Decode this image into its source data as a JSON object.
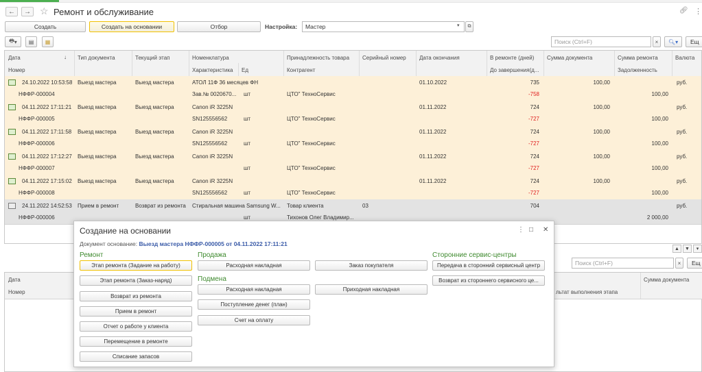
{
  "window": {
    "title": "Ремонт и обслуживание",
    "back": "←",
    "forward": "→",
    "star": "☆",
    "link_icon": "🔗",
    "more_icon": "⋮"
  },
  "toolbar": {
    "create": "Создать",
    "create_based_on": "Создать на основании",
    "filter": "Отбор",
    "setting_label": "Настройка:",
    "setting_value": "Мастер",
    "search_placeholder": "Поиск (Ctrl+F)",
    "more": "Ещ"
  },
  "table": {
    "headers_top": [
      "Дата",
      "Тип документа",
      "Текущий этап",
      "Номенклатура",
      "Принадлежность товара",
      "Серийный номер",
      "Дата окончания",
      "В ремонте (дней)",
      "Сумма документа",
      "Сумма ремонта",
      "Валюта"
    ],
    "headers_bottom": [
      "Номер",
      "Характеристика",
      "Ед",
      "Контрагент",
      "До завершения(д...",
      "Задолженность"
    ],
    "rows": [
      {
        "date": "24.10.2022 10:53:58",
        "number": "НФФР-000004",
        "doc_type": "Выезд мастера",
        "stage": "Выезд мастера",
        "nomenclature": "АТОЛ 11Ф 36 месяцев ФН",
        "characteristic": "Зав.№ 0020670...",
        "unit": "шт",
        "owner": "",
        "counterparty": "ЦТО\" ТехноСервис",
        "serial": "",
        "end_date": "01.10.2022",
        "days": "735",
        "remaining": "-758",
        "doc_sum": "100,00",
        "repair_sum": "",
        "debt": "100,00",
        "currency": "руб."
      },
      {
        "date": "04.11.2022 17:11:21",
        "number": "НФФР-000005",
        "doc_type": "Выезд мастера",
        "stage": "Выезд мастера",
        "nomenclature": "Canon iR 3225N",
        "characteristic": "SN125556562",
        "unit": "шт",
        "owner": "",
        "counterparty": "ЦТО\" ТехноСервис",
        "serial": "",
        "end_date": "01.11.2022",
        "days": "724",
        "remaining": "-727",
        "doc_sum": "100,00",
        "repair_sum": "",
        "debt": "100,00",
        "currency": "руб."
      },
      {
        "date": "04.11.2022 17:11:58",
        "number": "НФФР-000006",
        "doc_type": "Выезд мастера",
        "stage": "Выезд мастера",
        "nomenclature": "Canon iR 3225N",
        "characteristic": "SN125556562",
        "unit": "шт",
        "owner": "",
        "counterparty": "ЦТО\" ТехноСервис",
        "serial": "",
        "end_date": "01.11.2022",
        "days": "724",
        "remaining": "-727",
        "doc_sum": "100,00",
        "repair_sum": "",
        "debt": "100,00",
        "currency": "руб."
      },
      {
        "date": "04.11.2022 17:12:27",
        "number": "НФФР-000007",
        "doc_type": "Выезд мастера",
        "stage": "Выезд мастера",
        "nomenclature": "Canon iR 3225N",
        "characteristic": "",
        "unit": "шт",
        "owner": "",
        "counterparty": "ЦТО\" ТехноСервис",
        "serial": "",
        "end_date": "01.11.2022",
        "days": "724",
        "remaining": "-727",
        "doc_sum": "100,00",
        "repair_sum": "",
        "debt": "100,00",
        "currency": "руб."
      },
      {
        "date": "04.11.2022 17:15:02",
        "number": "НФФР-000008",
        "doc_type": "Выезд мастера",
        "stage": "Выезд мастера",
        "nomenclature": "Canon iR 3225N",
        "characteristic": "SN125556562",
        "unit": "шт",
        "owner": "",
        "counterparty": "ЦТО\" ТехноСервис",
        "serial": "",
        "end_date": "01.11.2022",
        "days": "724",
        "remaining": "-727",
        "doc_sum": "100,00",
        "repair_sum": "",
        "debt": "100,00",
        "currency": "руб."
      },
      {
        "date": "24.11.2022 14:52:53",
        "number": "НФФР-000006",
        "doc_type": "Прием в ремонт",
        "stage": "Возврат из ремонта",
        "nomenclature": "Стиральная машина Samsung W...",
        "characteristic": "",
        "unit": "шт",
        "owner": "Товар клиента",
        "counterparty": "Тихонов Олег Владимир...",
        "serial": "03",
        "end_date": "",
        "days": "704",
        "remaining": "",
        "doc_sum": "",
        "repair_sum": "",
        "debt": "2 000,00",
        "currency": "руб."
      }
    ]
  },
  "lower": {
    "search_placeholder": "Поиск (Ctrl+F)",
    "more": "Ещ",
    "headers": [
      "Дата",
      "Номер",
      "Сумма документа",
      "льтат выполнения этапа"
    ]
  },
  "modal": {
    "title": "Создание на основании",
    "basis_label": "Документ основание:",
    "basis_value": "Выезд мастера НФФР-000005 от 04.11.2022 17:11:21",
    "groups": {
      "repair": "Ремонт",
      "sale": "Продажа",
      "replacement": "Подмена",
      "external": "Сторонние сервис-центры"
    },
    "repair_buttons": [
      "Этап ремонта (Задание на работу)",
      "Этап ремонта (Заказ-наряд)",
      "Возврат из ремонта",
      "Прием в ремонт",
      "Отчет о работе у клиента",
      "Перемещение в ремонте",
      "Списание запасов"
    ],
    "sale_buttons": [
      "Расходная накладная",
      "Заказ покупателя"
    ],
    "replacement_buttons": [
      "Расходная накладная",
      "Приходная накладная",
      "Поступление денег (план)",
      "Счет на оплату"
    ],
    "external_buttons": [
      "Передача в сторонний сервисный центр",
      "Возврат из стороннего сервисного це..."
    ]
  }
}
